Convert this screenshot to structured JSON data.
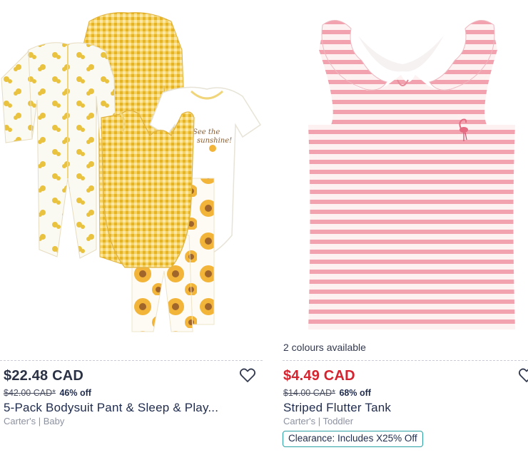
{
  "products": [
    {
      "price": "$22.48 CAD",
      "was_price": "$42.00 CAD*",
      "discount": "46% off",
      "title": "5-Pack Bodysuit Pant & Sleep & Play...",
      "brand": "Carter's | Baby",
      "image_icon": "baby-clothes-set-image",
      "colours_available": ""
    },
    {
      "price": "$4.49 CAD",
      "was_price": "$14.00 CAD*",
      "discount": "68% off",
      "title": "Striped Flutter Tank",
      "brand": "Carter's | Toddler",
      "badge": "Clearance: Includes X25% Off",
      "colours_available": "2 colours available",
      "image_icon": "striped-tank-image"
    }
  ],
  "colors": {
    "sale_price": "#d5242f",
    "regular_price": "#2b3245",
    "badge_border": "#2aa0a4",
    "gingham_yellow": "#f0c64a",
    "stripe_pink": "#f2a2ae"
  }
}
